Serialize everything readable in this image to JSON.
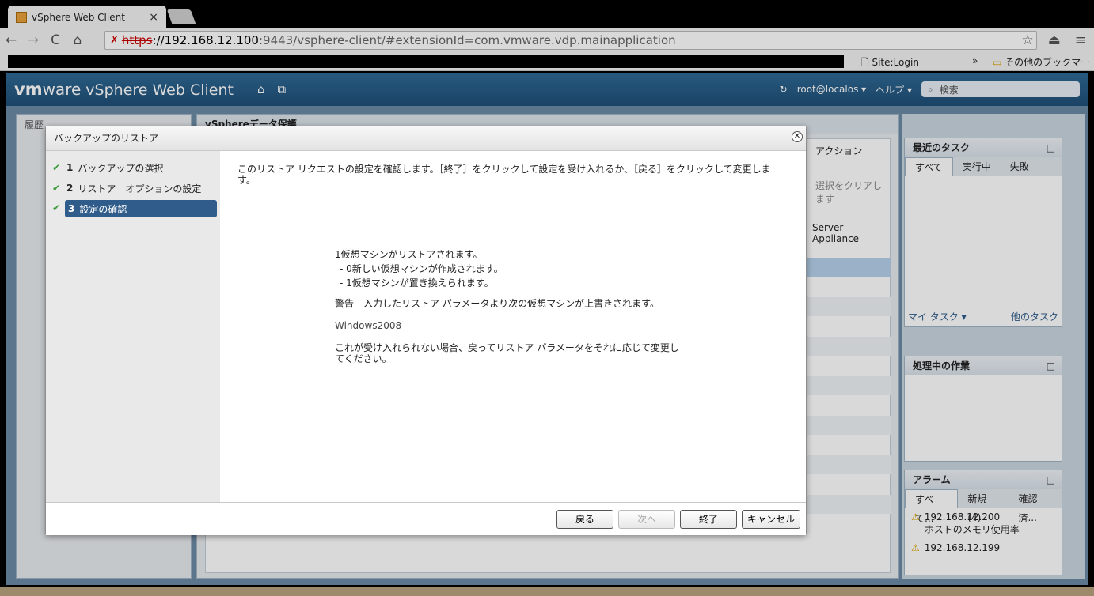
{
  "browser": {
    "tab_title": "vSphere Web Client",
    "tab_close": "×",
    "url_scheme": "https",
    "url_host": "://192.168.12.100",
    "url_rest": ":9443/vsphere-client/#extensionId=com.vmware.vdp.mainapplication",
    "bookmark_site_login": "Site:Login",
    "bookmark_other": "その他のブックマーク",
    "bookmark_more": "»"
  },
  "app": {
    "brand_vm": "vm",
    "brand_ware": "ware",
    "brand_product": "vSphere Web Client",
    "user": "root@localos ▾",
    "help": "ヘルプ ▾",
    "search_placeholder": "検索"
  },
  "left_panel": {
    "history": "履歴"
  },
  "mid_panel": {
    "title": "vSphereデータ保護",
    "action": "アクション",
    "clear_selection": "選択をクリアします",
    "column_cell": "Server Appliance"
  },
  "right_panel": {
    "recent_tasks": "最近のタスク",
    "tabs": [
      "すべて",
      "実行中",
      "失敗"
    ],
    "my_tasks": "マイ タスク ▾",
    "other_tasks": "他のタスク",
    "work_in_progress": "処理中の作業",
    "alarms": "アラーム",
    "alarm_tabs": [
      "すべて...",
      "新規 (4)",
      "確認済..."
    ],
    "alarm1_host": "192.168.12.200",
    "alarm1_text": "ホストのメモリ使用率",
    "alarm2_host": "192.168.12.199"
  },
  "dialog": {
    "title": "バックアップのリストア",
    "steps": [
      {
        "num": "1",
        "label": "バックアップの選択"
      },
      {
        "num": "2",
        "label": "リストア　オプションの設定"
      },
      {
        "num": "3",
        "label": "設定の確認"
      }
    ],
    "intro": "このリストア リクエストの設定を確認します。［終了］をクリックして設定を受け入れるか、［戻る］をクリックして変更します。",
    "summary_line1": "1仮想マシンがリストアされます。",
    "summary_line2": "- 0新しい仮想マシンが作成されます。",
    "summary_line3": "- 1仮想マシンが置き換えられます。",
    "warning": "警告 - 入力したリストア パラメータより次の仮想マシンが上書きされます。",
    "vm_name": "Windows2008",
    "note": "これが受け入れられない場合、戻ってリストア パラメータをそれに応じて変更してください。",
    "btn_back": "戻る",
    "btn_next": "次へ",
    "btn_finish": "終了",
    "btn_cancel": "キャンセル"
  }
}
